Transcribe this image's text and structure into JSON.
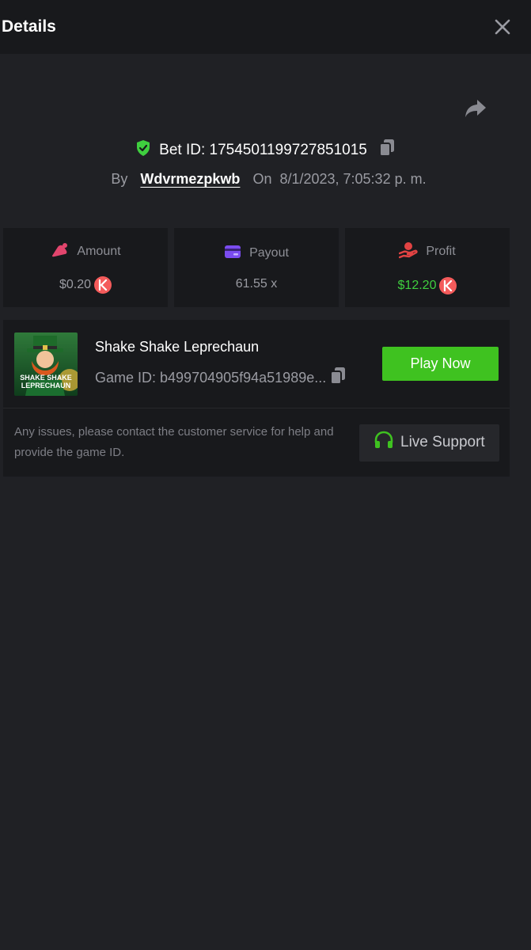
{
  "header": {
    "title": "Details"
  },
  "bet": {
    "id_text": "Bet ID: 1754501199727851015",
    "by_label": "By",
    "username": "Wdvrmezpkwb",
    "on_label": "On",
    "date": "8/1/2023, 7:05:32 p. m."
  },
  "stats": {
    "amount": {
      "label": "Amount",
      "value": "$0.20",
      "color": "#e2456d"
    },
    "payout": {
      "label": "Payout",
      "value": "61.55 x",
      "color": "#7b4cf0"
    },
    "profit": {
      "label": "Profit",
      "value": "$12.20",
      "color": "#e24343",
      "value_color": "#3fcf3f"
    }
  },
  "game": {
    "name": "Shake Shake Leprechaun",
    "id_text": "Game ID: b499704905f94a51989e...",
    "thumb_text_1": "SHAKE SHAKE",
    "thumb_text_2": "LEPRECHAUN",
    "play_label": "Play Now"
  },
  "support": {
    "help_text": "Any issues, please contact the customer service for help and provide the game ID.",
    "button_label": "Live Support",
    "accent": "#3fc220"
  },
  "icons": [
    "close-icon",
    "share-icon",
    "shield-check-icon",
    "copy-icon",
    "cap-icon",
    "card-icon",
    "hand-heart-icon",
    "coin-icon",
    "headset-icon"
  ]
}
